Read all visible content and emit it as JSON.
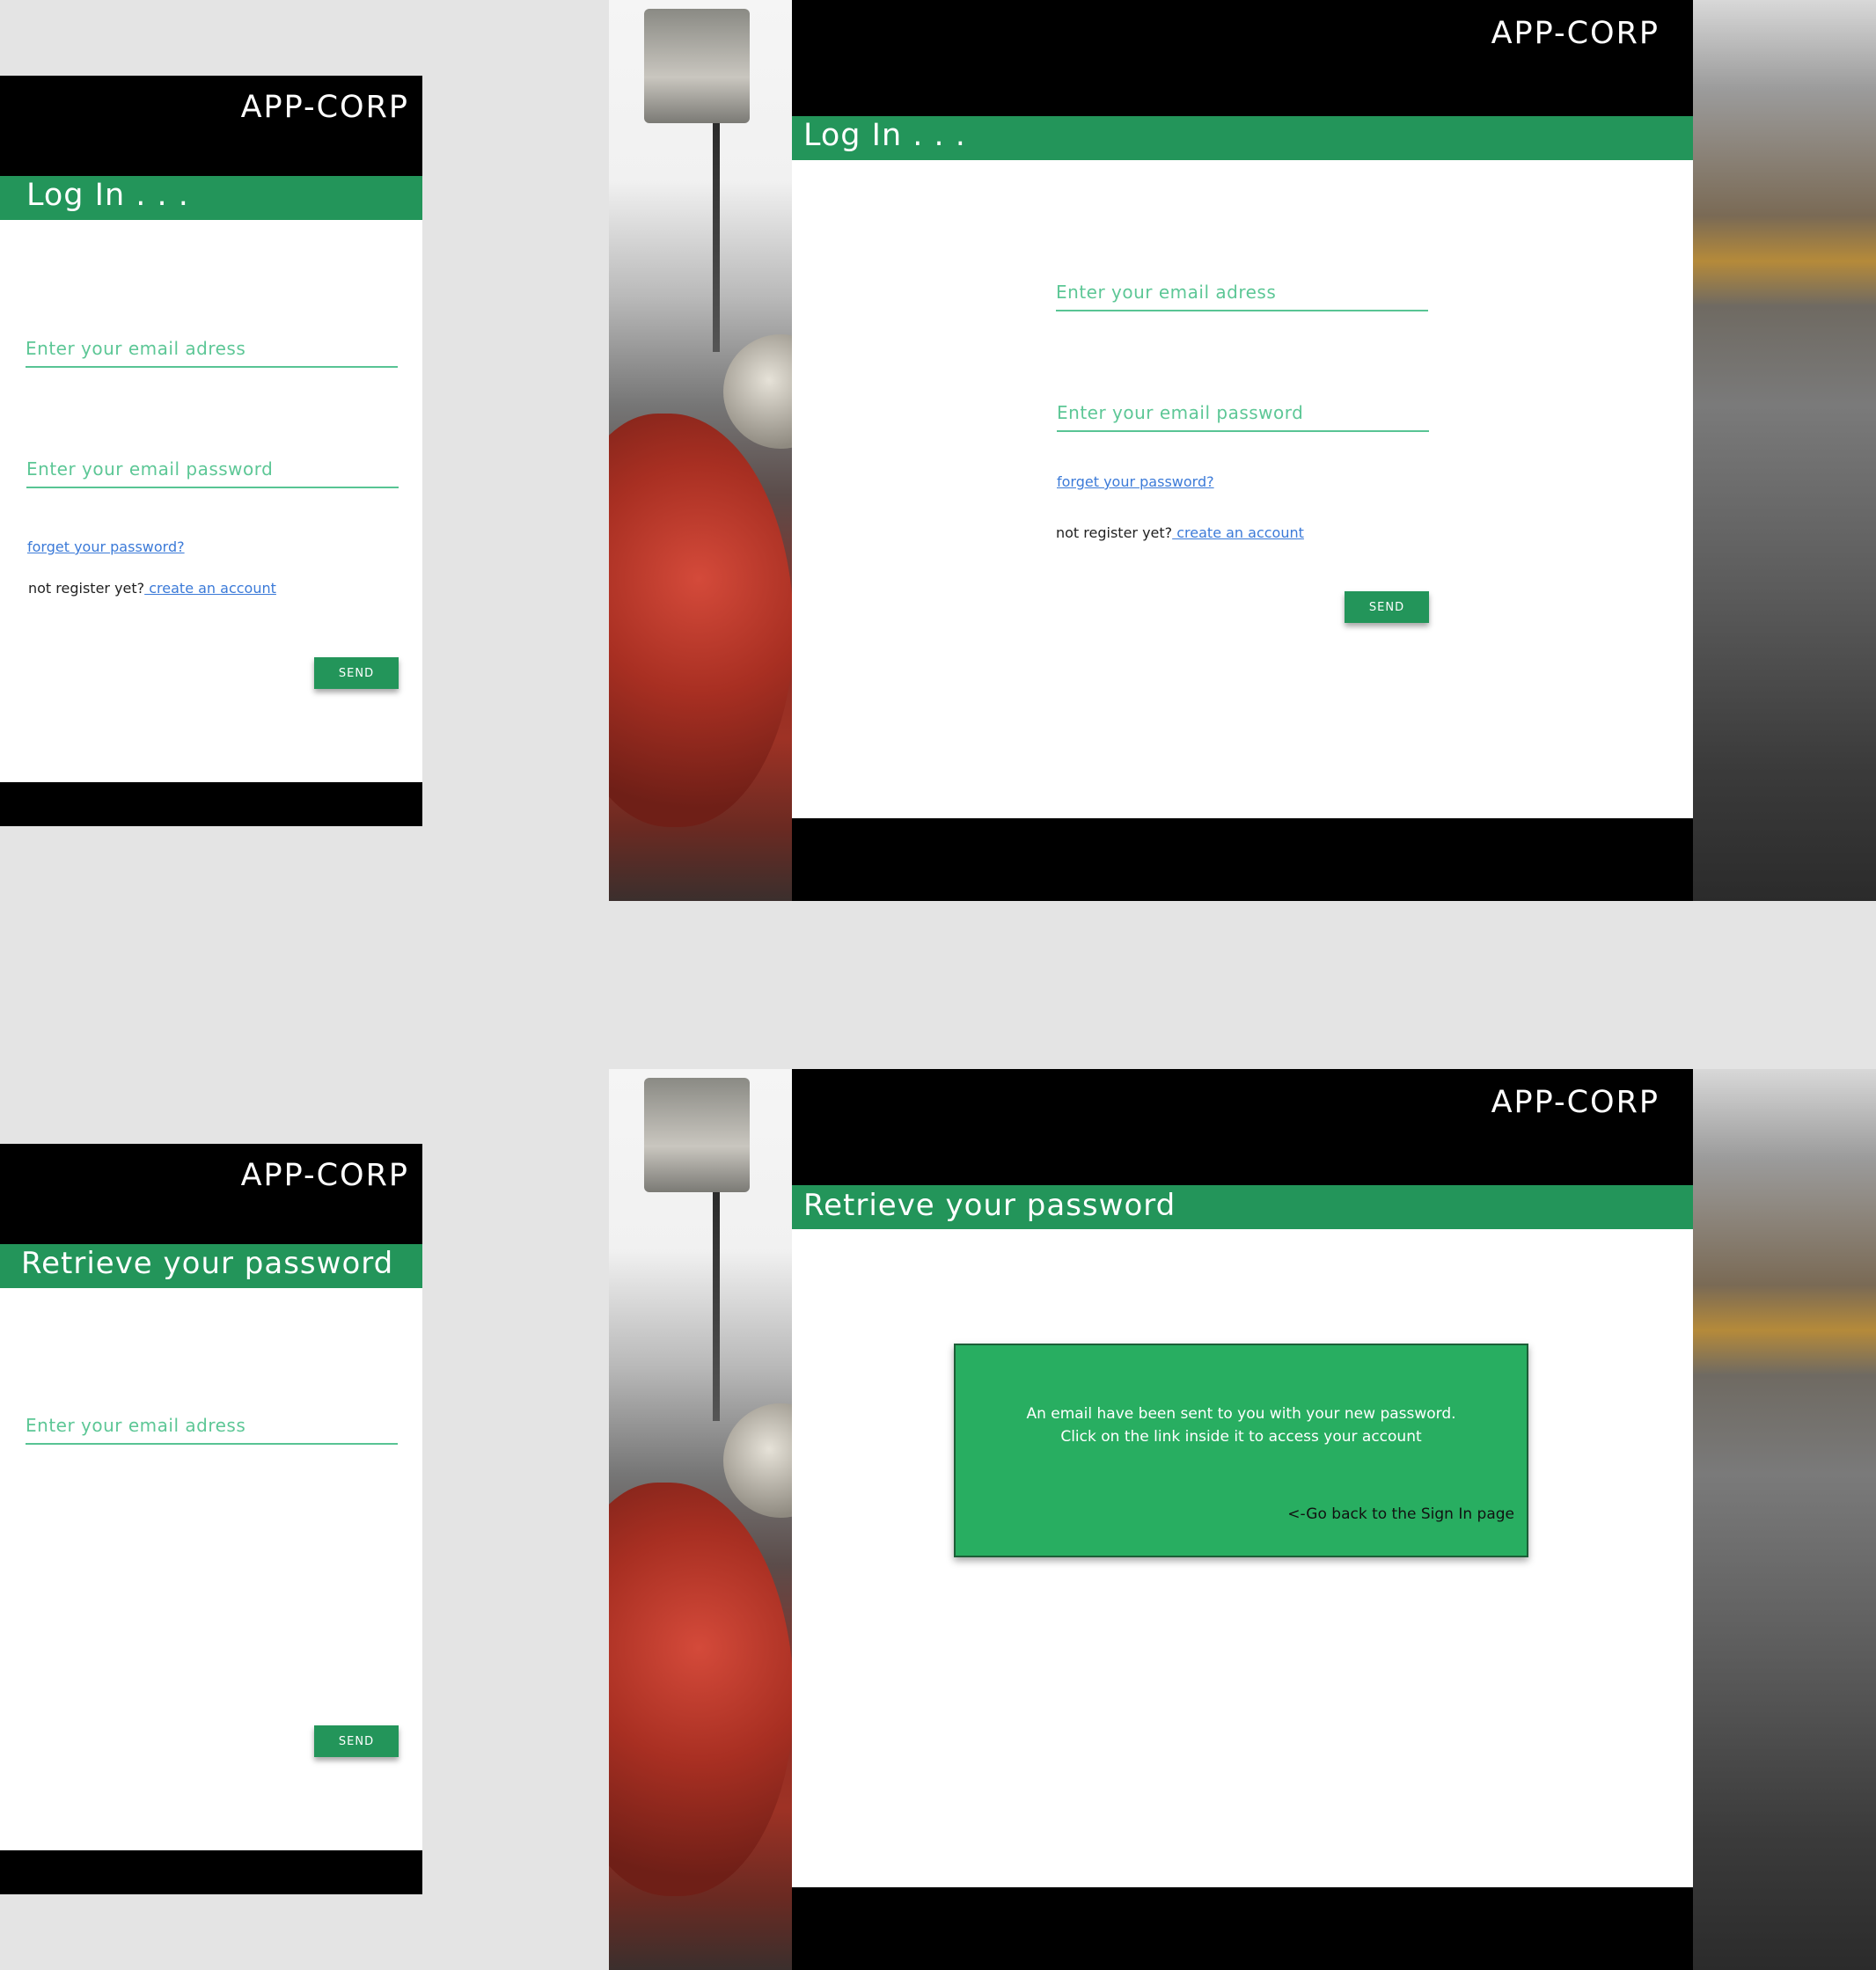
{
  "brand": "APP-CORP",
  "login": {
    "title": "Log In . . .",
    "email_placeholder": "Enter your email adress",
    "password_placeholder": "Enter your email password",
    "forgot_link": "forget your password?",
    "register_prompt": "not register yet?",
    "register_link": " create an account",
    "send_label": "SEND"
  },
  "retrieve": {
    "title": "Retrieve your password",
    "email_placeholder": "Enter your email adress",
    "send_label": "SEND",
    "notice_line1": "An email have been sent to you with your new password.",
    "notice_line2": "Click on the link inside it to access your account",
    "back_link": "<-Go back to the Sign In page"
  },
  "colors": {
    "accent_green": "#23955a",
    "notice_green": "#28ae61",
    "header_black": "#000000",
    "input_underline": "#58c494",
    "link_blue": "#3b7ad8",
    "page_background": "#e4e4e4"
  }
}
